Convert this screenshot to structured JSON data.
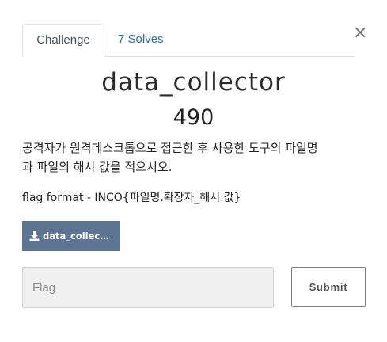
{
  "modal": {
    "close_label": "×"
  },
  "tabs": [
    {
      "label": "Challenge",
      "active": true
    },
    {
      "label": "7 Solves",
      "active": false
    }
  ],
  "challenge": {
    "name": "data_collector",
    "points": "490",
    "description_lines": [
      "공격자가 원격데스크톱으로 접근한 후 사용한 도구의 파일명",
      "과 파일의 해시 값을 적으시오."
    ],
    "flag_format": "flag format - INCO{파일명.확장자_해시 값}",
    "file_button_label": "data_collect..."
  },
  "form": {
    "flag_placeholder": "Flag",
    "submit_label": "Submit"
  },
  "icons": {
    "download": "download-icon",
    "close": "close-icon"
  },
  "colors": {
    "file_button_bg": "#5d7593",
    "tab_link": "#2b6cb0",
    "input_bg": "#f0f0f0"
  }
}
